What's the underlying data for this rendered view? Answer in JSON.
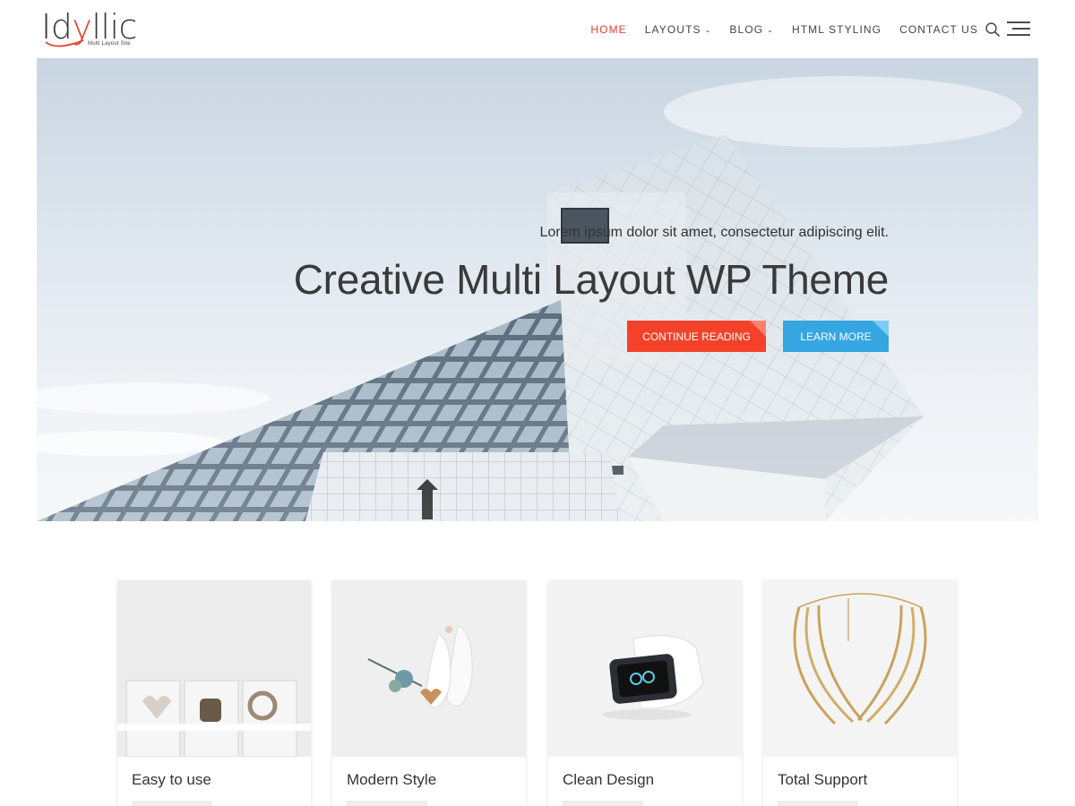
{
  "site": {
    "logo_text_part1": "Id",
    "logo_text_y": "y",
    "logo_text_part2": "llic",
    "tagline": "Multi Layout Site"
  },
  "nav": {
    "items": [
      {
        "label": "HOME",
        "active": true,
        "dropdown": false
      },
      {
        "label": "LAYOUTS",
        "active": false,
        "dropdown": true
      },
      {
        "label": "BLOG",
        "active": false,
        "dropdown": true
      },
      {
        "label": "HTML STYLING",
        "active": false,
        "dropdown": false
      },
      {
        "label": "CONTACT US",
        "active": false,
        "dropdown": false
      }
    ],
    "search_icon": "search-icon",
    "menu_icon": "hamburger-menu-icon"
  },
  "hero": {
    "subtitle": "Lorem ipsum dolor sit amet, consectetur adipiscing elit.",
    "title": "Creative Multi Layout WP Theme",
    "primary_button": "CONTINUE READING",
    "secondary_button": "LEARN MORE"
  },
  "features": [
    {
      "title": "Easy to use"
    },
    {
      "title": "Modern Style"
    },
    {
      "title": "Clean Design"
    },
    {
      "title": "Total Support"
    }
  ],
  "colors": {
    "accent": "#e8402e",
    "button_red": "#f4422a",
    "button_blue": "#35a6e2",
    "text": "#333333"
  }
}
